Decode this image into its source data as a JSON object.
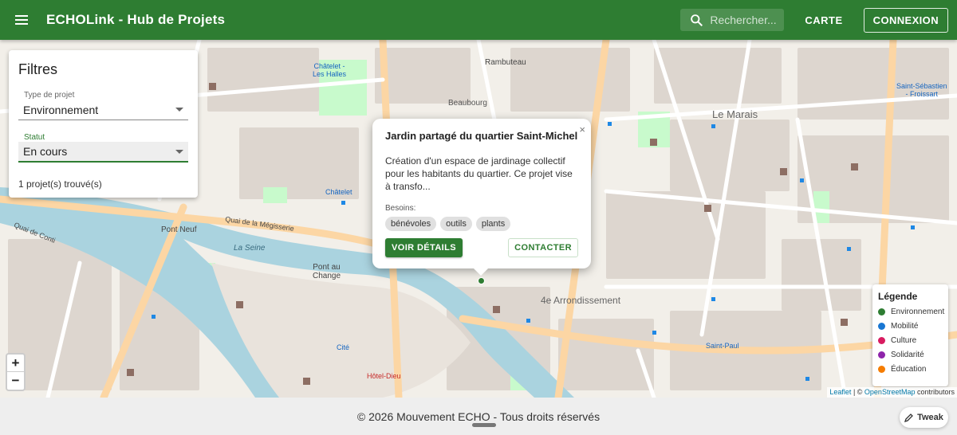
{
  "appbar": {
    "title": "ECHOLink - Hub de Projets",
    "search_placeholder": "Rechercher...",
    "nav_map": "CARTE",
    "login": "CONNEXION"
  },
  "filters": {
    "title": "Filtres",
    "type_label": "Type de projet",
    "type_value": "Environnement",
    "status_label": "Statut",
    "status_value": "En cours",
    "result_count": "1 projet(s) trouvé(s)"
  },
  "map_labels": {
    "rambuteau": "Rambuteau",
    "chatelet_halles": "Châtelet -\nLes Halles",
    "beaubourg": "Beaubourg",
    "le_marais": "Le Marais",
    "chatelet": "Châtelet",
    "pont_neuf": "Pont Neuf",
    "la_seine": "La Seine",
    "pont_au_change": "Pont au\nChange",
    "cite": "Cité",
    "hotel_dieu": "Hôtel-Dieu",
    "arrondissement": "4e Arrondissement",
    "saint_paul": "Saint-Paul",
    "saint_sebastien": "Saint-Sébastien\n- Froissart",
    "quai_megisserie": "Quai de la Mégisserie",
    "quai_conti": "Quai de Conti"
  },
  "popup": {
    "close": "×",
    "title": "Jardin partagé du quartier Saint-Michel",
    "description": "Création d'un espace de jardinage collectif pour les habitants du quartier. Ce projet vise à transfo...",
    "needs_label": "Besoins:",
    "needs": [
      "bénévoles",
      "outils",
      "plants"
    ],
    "details_button": "VOIR DÉTAILS",
    "contact_button": "CONTACTER"
  },
  "legend": {
    "title": "Légende",
    "items": [
      {
        "label": "Environnement",
        "color": "#2e7d32"
      },
      {
        "label": "Mobilité",
        "color": "#1976d2"
      },
      {
        "label": "Culture",
        "color": "#d81b60"
      },
      {
        "label": "Solidarité",
        "color": "#8e24aa"
      },
      {
        "label": "Éducation",
        "color": "#f57c00"
      }
    ]
  },
  "zoom": {
    "in": "+",
    "out": "−"
  },
  "attribution": {
    "leaflet": "Leaflet",
    "sep": " | © ",
    "osm": "OpenStreetMap",
    "contributors": " contributors"
  },
  "footer": {
    "copyright": "© 2026 Mouvement ECHO - Tous droits réservés"
  },
  "tweak": {
    "label": "Tweak"
  }
}
